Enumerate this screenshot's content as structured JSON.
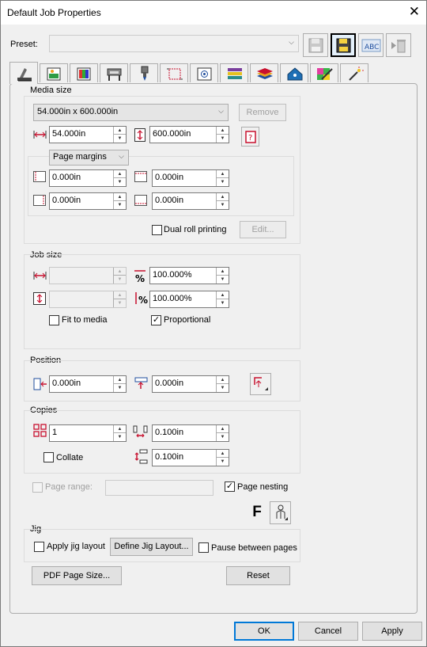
{
  "window": {
    "title": "Default Job Properties",
    "close": "✕"
  },
  "preset": {
    "label": "Preset:",
    "value": ""
  },
  "tabs": [
    {
      "name": "tab-media",
      "active": true
    },
    {
      "name": "tab-image"
    },
    {
      "name": "tab-color"
    },
    {
      "name": "tab-printer"
    },
    {
      "name": "tab-cutter"
    },
    {
      "name": "tab-marks"
    },
    {
      "name": "tab-layout"
    },
    {
      "name": "tab-tiling"
    },
    {
      "name": "tab-layers"
    },
    {
      "name": "tab-finishing"
    },
    {
      "name": "tab-spot-color"
    },
    {
      "name": "tab-wizard"
    }
  ],
  "media": {
    "title": "Media size",
    "selected": "54.000in x 600.000in",
    "remove": "Remove",
    "width": "54.000in",
    "height": "600.000in",
    "margins_mode": "Page margins",
    "margin_left": "0.000in",
    "margin_top": "0.000in",
    "margin_right": "0.000in",
    "margin_bottom": "0.000in",
    "dual_roll": "Dual roll printing",
    "edit": "Edit..."
  },
  "job": {
    "title": "Job size",
    "width": "",
    "height": "",
    "scale_x": "100.000%",
    "scale_y": "100.000%",
    "fit": "Fit to media",
    "proportional": "Proportional",
    "proportional_checked": "✓"
  },
  "position": {
    "title": "Position",
    "x": "0.000in",
    "y": "0.000in"
  },
  "copies": {
    "title": "Copies",
    "count": "1",
    "gap_h": "0.100in",
    "gap_v": "0.100in",
    "collate": "Collate"
  },
  "page_range": {
    "label": "Page range:",
    "value": ""
  },
  "page_nesting": {
    "label": "Page nesting",
    "checked": "✓"
  },
  "nest_letter": "F",
  "jig": {
    "title": "Jig",
    "apply": "Apply jig layout",
    "define": "Define Jig Layout...",
    "pause": "Pause between pages"
  },
  "pdf_button": "PDF Page Size...",
  "reset_button": "Reset",
  "footer": {
    "ok": "OK",
    "cancel": "Cancel",
    "apply": "Apply"
  },
  "colors": {
    "accent": "#0078d7",
    "icon_red": "#c8102e",
    "icon_blue": "#1f4e9e"
  }
}
